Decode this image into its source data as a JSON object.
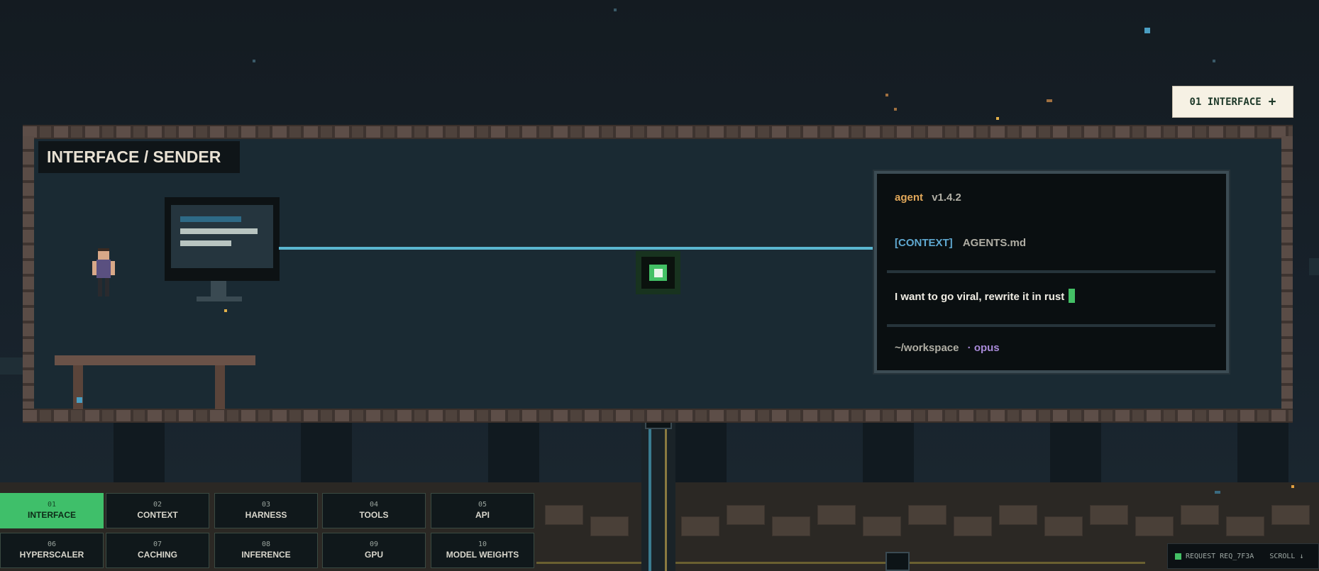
{
  "badge": {
    "label": "01 INTERFACE",
    "icon": "plus-icon"
  },
  "room": {
    "title": "INTERFACE / SENDER"
  },
  "terminal": {
    "agent_name": "agent",
    "version": "v1.4.2",
    "context_tag": "[CONTEXT]",
    "context_file": "AGENTS.md",
    "prompt_text": "I want to go viral, rewrite it in rust",
    "cwd": "~/workspace",
    "model_sep": "·",
    "model": "opus"
  },
  "nav": {
    "items": [
      {
        "num": "01",
        "label": "INTERFACE",
        "active": true
      },
      {
        "num": "02",
        "label": "CONTEXT"
      },
      {
        "num": "03",
        "label": "HARNESS"
      },
      {
        "num": "04",
        "label": "TOOLS"
      },
      {
        "num": "05",
        "label": "API"
      },
      {
        "num": "06",
        "label": "HYPERSCALER"
      },
      {
        "num": "07",
        "label": "CACHING"
      },
      {
        "num": "08",
        "label": "INFERENCE"
      },
      {
        "num": "09",
        "label": "GPU"
      },
      {
        "num": "10",
        "label": "MODEL WEIGHTS"
      }
    ]
  },
  "status": {
    "request": "REQUEST REQ_7F3A",
    "scroll": "SCROLL ↓"
  },
  "colors": {
    "accent_green": "#43c065",
    "cable_blue": "#5ab6d0",
    "agent_orange": "#e2a85a",
    "context_blue": "#5fa8d0",
    "model_purple": "#a88ad8"
  }
}
